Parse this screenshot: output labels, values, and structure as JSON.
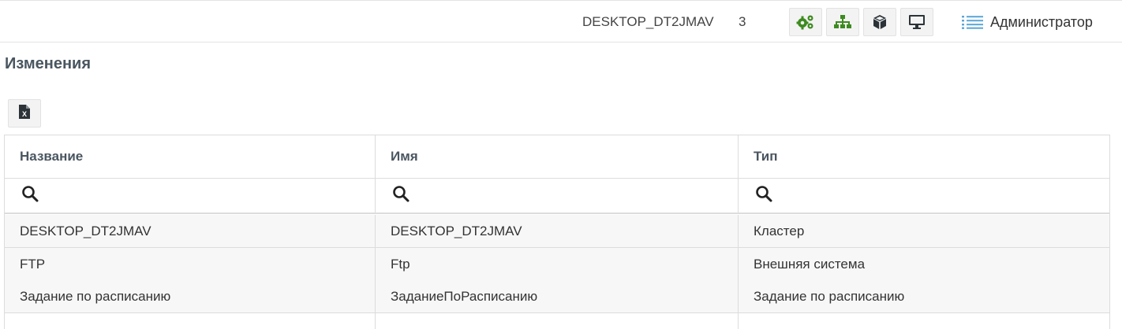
{
  "header": {
    "host_name": "DESKTOP_DT2JMAV",
    "count": "3",
    "icons": [
      "gears-icon",
      "sitemap-icon",
      "cube-icon",
      "monitor-icon"
    ],
    "user_menu_icon": "list-icon",
    "user_name": "Администратор",
    "icon_color": "#3d8b1f"
  },
  "page": {
    "title": "Изменения"
  },
  "toolbar": {
    "export_icon": "excel-file-icon"
  },
  "table": {
    "columns": [
      "Название",
      "Имя",
      "Тип"
    ],
    "filter_icon": "search-icon",
    "rows": [
      [
        "DESKTOP_DT2JMAV",
        "DESKTOP_DT2JMAV",
        "Кластер"
      ],
      [
        "FTP",
        "Ftp",
        "Внешняя система"
      ],
      [
        "Задание по расписанию",
        "ЗаданиеПоРасписанию",
        "Задание по расписанию"
      ]
    ]
  }
}
